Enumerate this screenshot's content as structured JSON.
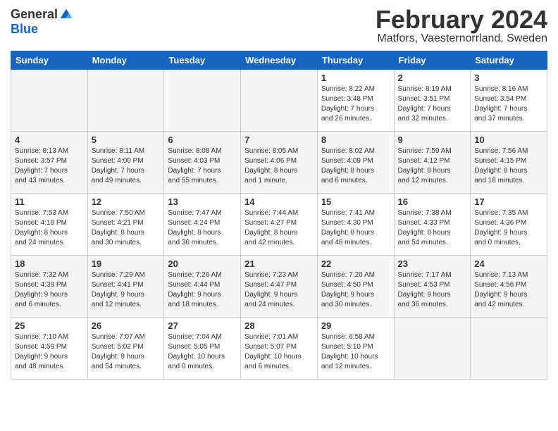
{
  "header": {
    "logo_general": "General",
    "logo_blue": "Blue",
    "title": "February 2024",
    "subtitle": "Matfors, Vaesternorrland, Sweden"
  },
  "columns": [
    "Sunday",
    "Monday",
    "Tuesday",
    "Wednesday",
    "Thursday",
    "Friday",
    "Saturday"
  ],
  "weeks": [
    [
      {
        "day": "",
        "detail": ""
      },
      {
        "day": "",
        "detail": ""
      },
      {
        "day": "",
        "detail": ""
      },
      {
        "day": "",
        "detail": ""
      },
      {
        "day": "1",
        "detail": "Sunrise: 8:22 AM\nSunset: 3:48 PM\nDaylight: 7 hours\nand 26 minutes."
      },
      {
        "day": "2",
        "detail": "Sunrise: 8:19 AM\nSunset: 3:51 PM\nDaylight: 7 hours\nand 32 minutes."
      },
      {
        "day": "3",
        "detail": "Sunrise: 8:16 AM\nSunset: 3:54 PM\nDaylight: 7 hours\nand 37 minutes."
      }
    ],
    [
      {
        "day": "4",
        "detail": "Sunrise: 8:13 AM\nSunset: 3:57 PM\nDaylight: 7 hours\nand 43 minutes."
      },
      {
        "day": "5",
        "detail": "Sunrise: 8:11 AM\nSunset: 4:00 PM\nDaylight: 7 hours\nand 49 minutes."
      },
      {
        "day": "6",
        "detail": "Sunrise: 8:08 AM\nSunset: 4:03 PM\nDaylight: 7 hours\nand 55 minutes."
      },
      {
        "day": "7",
        "detail": "Sunrise: 8:05 AM\nSunset: 4:06 PM\nDaylight: 8 hours\nand 1 minute."
      },
      {
        "day": "8",
        "detail": "Sunrise: 8:02 AM\nSunset: 4:09 PM\nDaylight: 8 hours\nand 6 minutes."
      },
      {
        "day": "9",
        "detail": "Sunrise: 7:59 AM\nSunset: 4:12 PM\nDaylight: 8 hours\nand 12 minutes."
      },
      {
        "day": "10",
        "detail": "Sunrise: 7:56 AM\nSunset: 4:15 PM\nDaylight: 8 hours\nand 18 minutes."
      }
    ],
    [
      {
        "day": "11",
        "detail": "Sunrise: 7:53 AM\nSunset: 4:18 PM\nDaylight: 8 hours\nand 24 minutes."
      },
      {
        "day": "12",
        "detail": "Sunrise: 7:50 AM\nSunset: 4:21 PM\nDaylight: 8 hours\nand 30 minutes."
      },
      {
        "day": "13",
        "detail": "Sunrise: 7:47 AM\nSunset: 4:24 PM\nDaylight: 8 hours\nand 36 minutes."
      },
      {
        "day": "14",
        "detail": "Sunrise: 7:44 AM\nSunset: 4:27 PM\nDaylight: 8 hours\nand 42 minutes."
      },
      {
        "day": "15",
        "detail": "Sunrise: 7:41 AM\nSunset: 4:30 PM\nDaylight: 8 hours\nand 48 minutes."
      },
      {
        "day": "16",
        "detail": "Sunrise: 7:38 AM\nSunset: 4:33 PM\nDaylight: 8 hours\nand 54 minutes."
      },
      {
        "day": "17",
        "detail": "Sunrise: 7:35 AM\nSunset: 4:36 PM\nDaylight: 9 hours\nand 0 minutes."
      }
    ],
    [
      {
        "day": "18",
        "detail": "Sunrise: 7:32 AM\nSunset: 4:39 PM\nDaylight: 9 hours\nand 6 minutes."
      },
      {
        "day": "19",
        "detail": "Sunrise: 7:29 AM\nSunset: 4:41 PM\nDaylight: 9 hours\nand 12 minutes."
      },
      {
        "day": "20",
        "detail": "Sunrise: 7:26 AM\nSunset: 4:44 PM\nDaylight: 9 hours\nand 18 minutes."
      },
      {
        "day": "21",
        "detail": "Sunrise: 7:23 AM\nSunset: 4:47 PM\nDaylight: 9 hours\nand 24 minutes."
      },
      {
        "day": "22",
        "detail": "Sunrise: 7:20 AM\nSunset: 4:50 PM\nDaylight: 9 hours\nand 30 minutes."
      },
      {
        "day": "23",
        "detail": "Sunrise: 7:17 AM\nSunset: 4:53 PM\nDaylight: 9 hours\nand 36 minutes."
      },
      {
        "day": "24",
        "detail": "Sunrise: 7:13 AM\nSunset: 4:56 PM\nDaylight: 9 hours\nand 42 minutes."
      }
    ],
    [
      {
        "day": "25",
        "detail": "Sunrise: 7:10 AM\nSunset: 4:59 PM\nDaylight: 9 hours\nand 48 minutes."
      },
      {
        "day": "26",
        "detail": "Sunrise: 7:07 AM\nSunset: 5:02 PM\nDaylight: 9 hours\nand 54 minutes."
      },
      {
        "day": "27",
        "detail": "Sunrise: 7:04 AM\nSunset: 5:05 PM\nDaylight: 10 hours\nand 0 minutes."
      },
      {
        "day": "28",
        "detail": "Sunrise: 7:01 AM\nSunset: 5:07 PM\nDaylight: 10 hours\nand 6 minutes."
      },
      {
        "day": "29",
        "detail": "Sunrise: 6:58 AM\nSunset: 5:10 PM\nDaylight: 10 hours\nand 12 minutes."
      },
      {
        "day": "",
        "detail": ""
      },
      {
        "day": "",
        "detail": ""
      }
    ]
  ]
}
